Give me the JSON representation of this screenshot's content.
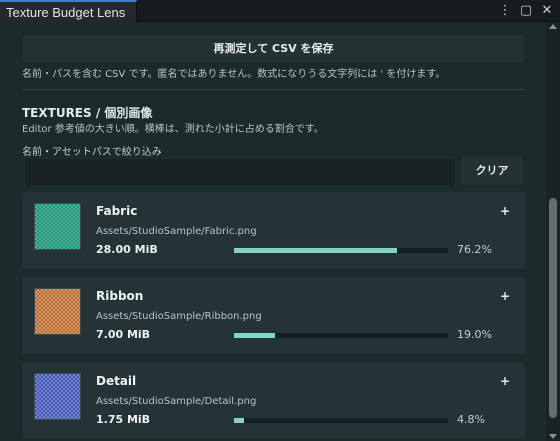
{
  "window": {
    "tab_title": "Texture Budget Lens",
    "icons": [
      "more-options-icon",
      "maximize-icon",
      "close-icon"
    ]
  },
  "header": {
    "save_button_label": "再測定して CSV を保存",
    "save_hint": "名前・パスを含む CSV です。匿名ではありません。数式になりうる文字列には ' を付けます。"
  },
  "textures": {
    "title": "TEXTURES  /  個別画像",
    "description": "Editor 参考値の大きい順。横棒は、測れた小計に占める割合です。",
    "filter_label": "名前・アセットパスで絞り込み",
    "filter_value": "",
    "filter_placeholder": "",
    "clear_label": "クリア",
    "items": [
      {
        "name": "Fabric",
        "path": "Assets/StudioSample/Fabric.png",
        "size": "28.00 MiB",
        "percent_label": "76.2%",
        "fraction": 0.762,
        "color_a": "#2f8f7a",
        "color_b": "#45b39a",
        "plus": "+"
      },
      {
        "name": "Ribbon",
        "path": "Assets/StudioSample/Ribbon.png",
        "size": "7.00 MiB",
        "percent_label": "19.0%",
        "fraction": 0.19,
        "color_a": "#b07040",
        "color_b": "#d8955a",
        "plus": "+"
      },
      {
        "name": "Detail",
        "path": "Assets/StudioSample/Detail.png",
        "size": "1.75 MiB",
        "percent_label": "4.8%",
        "fraction": 0.048,
        "color_a": "#4a5cae",
        "color_b": "#6f80d4",
        "plus": "+"
      }
    ]
  },
  "colors": {
    "accent": "#86d3c1",
    "tab_highlight": "#3f7ac8",
    "background": "#1b2a2a",
    "card": "#243335"
  }
}
